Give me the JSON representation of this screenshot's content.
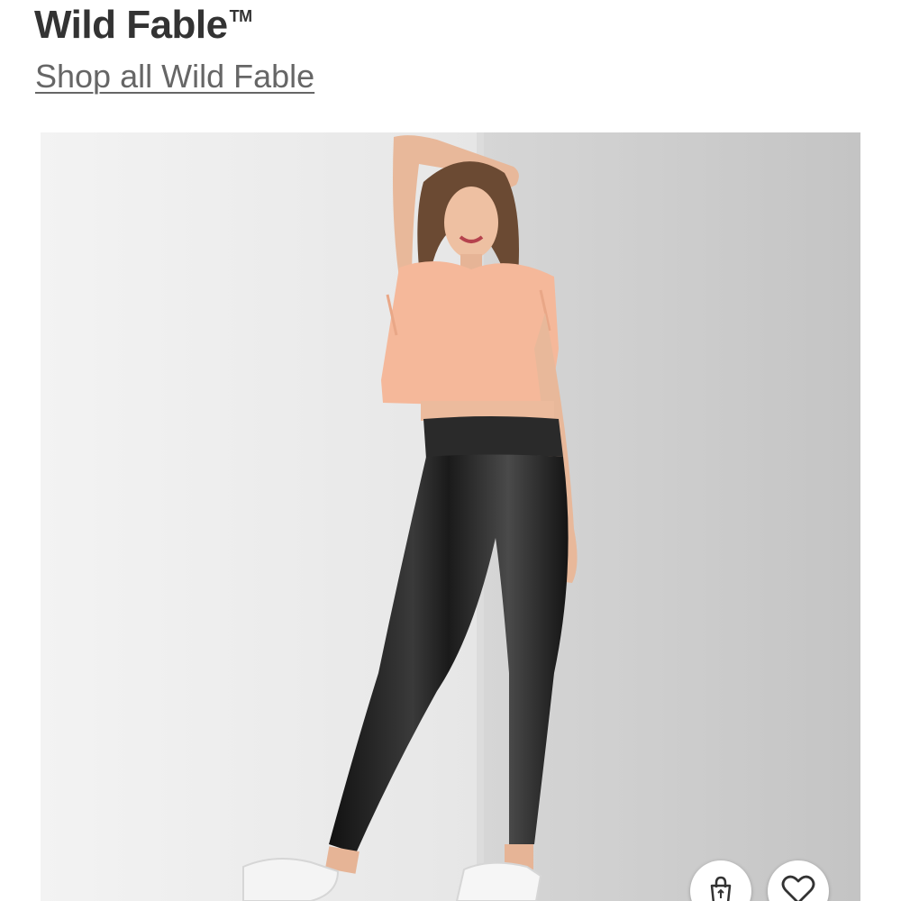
{
  "brand": {
    "name": "Wild Fable",
    "trademark": "TM",
    "shop_link_label": "Shop all Wild Fable"
  },
  "product_image": {
    "colors": {
      "left_wall": "#eeeeee",
      "right_wall": "#c9c9c9",
      "top_color": "#f5b89a",
      "leggings_color": "#1f1f1f"
    }
  },
  "actions": {
    "add_to_bag_icon": "shopping-bag-icon",
    "favorite_icon": "heart-icon"
  }
}
